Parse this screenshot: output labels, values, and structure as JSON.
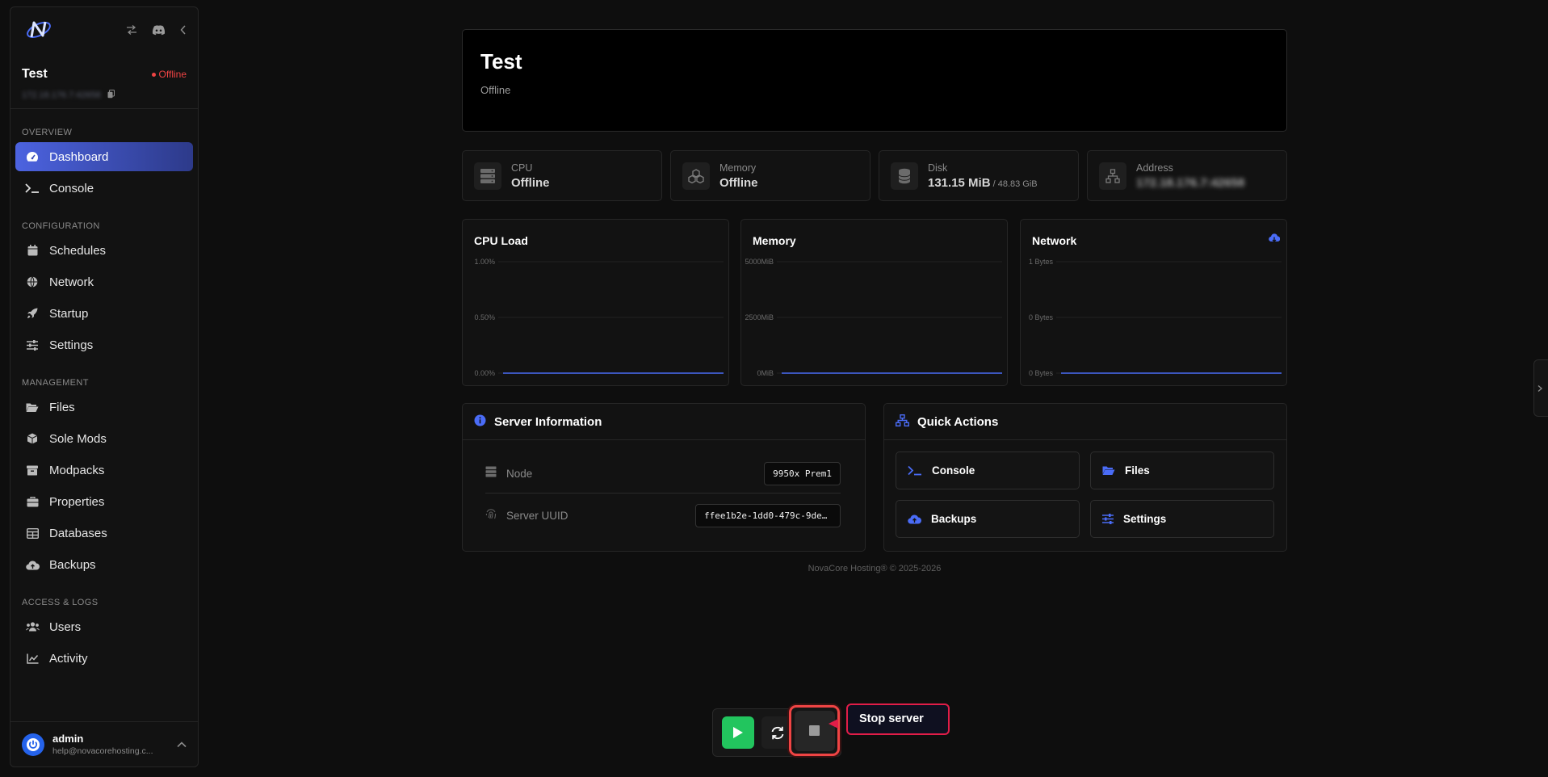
{
  "sidebar": {
    "server_name": "Test",
    "server_status": "Offline",
    "server_address_blurred": "172.18.176.7:42658",
    "sections": {
      "overview": "OVERVIEW",
      "configuration": "CONFIGURATION",
      "management": "MANAGEMENT",
      "access_logs": "ACCESS & LOGS"
    },
    "items": [
      {
        "label": "Dashboard",
        "icon": "gauge-icon"
      },
      {
        "label": "Console",
        "icon": "terminal-icon"
      },
      {
        "label": "Schedules",
        "icon": "calendar-icon"
      },
      {
        "label": "Network",
        "icon": "globe-icon"
      },
      {
        "label": "Startup",
        "icon": "rocket-icon"
      },
      {
        "label": "Settings",
        "icon": "sliders-icon"
      },
      {
        "label": "Files",
        "icon": "folder-icon"
      },
      {
        "label": "Sole Mods",
        "icon": "box-icon"
      },
      {
        "label": "Modpacks",
        "icon": "archive-icon"
      },
      {
        "label": "Properties",
        "icon": "toolbox-icon"
      },
      {
        "label": "Databases",
        "icon": "table-icon"
      },
      {
        "label": "Backups",
        "icon": "cloud-upload-icon"
      },
      {
        "label": "Users",
        "icon": "users-icon"
      },
      {
        "label": "Activity",
        "icon": "chart-line-icon"
      }
    ],
    "user": {
      "name": "admin",
      "email": "help@novacorehosting.c..."
    }
  },
  "header": {
    "title": "Test",
    "status": "Offline"
  },
  "stats": {
    "cpu": {
      "label": "CPU",
      "value": "Offline"
    },
    "memory": {
      "label": "Memory",
      "value": "Offline"
    },
    "disk": {
      "label": "Disk",
      "value": "131.15 MiB",
      "limit": " / 48.83 GiB"
    },
    "address": {
      "label": "Address",
      "value": "172.18.176.7:42658"
    }
  },
  "chart_data": [
    {
      "type": "line",
      "title": "CPU Load",
      "ytick_labels": [
        "1.00%",
        "0.50%",
        "0.00%"
      ],
      "ylim": [
        0,
        1
      ],
      "values": [
        0,
        0,
        0,
        0,
        0,
        0,
        0,
        0,
        0,
        0
      ],
      "grid": true
    },
    {
      "type": "line",
      "title": "Memory",
      "ytick_labels": [
        "5000MiB",
        "2500MiB",
        "0MiB"
      ],
      "ylim": [
        0,
        5000
      ],
      "values": [
        0,
        0,
        0,
        0,
        0,
        0,
        0,
        0,
        0,
        0
      ],
      "grid": true
    },
    {
      "type": "line",
      "title": "Network",
      "ytick_labels": [
        "1 Bytes",
        "0 Bytes",
        "0 Bytes"
      ],
      "ylim": [
        0,
        1
      ],
      "values": [
        0,
        0,
        0,
        0,
        0,
        0,
        0,
        0,
        0,
        0
      ],
      "grid": true
    }
  ],
  "server_info": {
    "title": "Server Information",
    "node_label": "Node",
    "node_value": "9950x Prem1",
    "uuid_label": "Server UUID",
    "uuid_value": "ffee1b2e-1dd0-479c-9de2-..."
  },
  "quick_actions": {
    "title": "Quick Actions",
    "console": "Console",
    "files": "Files",
    "backups": "Backups",
    "settings": "Settings"
  },
  "footer": "NovaCore Hosting® © 2025-2026",
  "power": {
    "tooltip": "Stop server"
  },
  "colors": {
    "accent": "#4a6cf7",
    "danger": "#ef4444",
    "success": "#22c55e"
  }
}
